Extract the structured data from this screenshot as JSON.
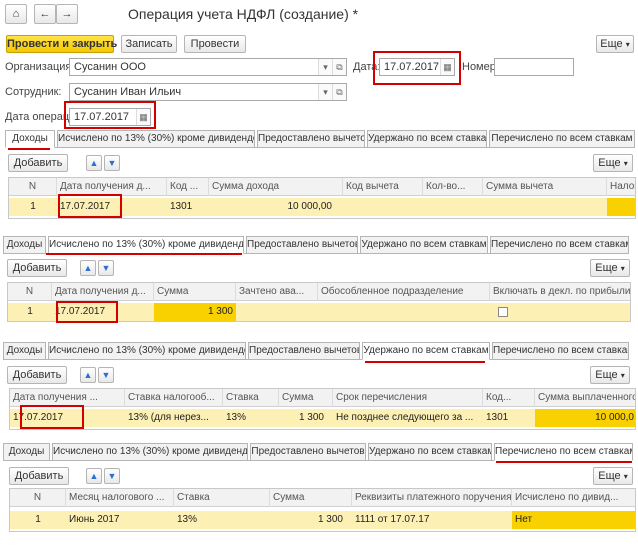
{
  "window": {
    "title": "Операция учета НДФЛ (создание) *"
  },
  "toolbar": {
    "post_close": "Провести и закрыть",
    "save": "Записать",
    "post": "Провести",
    "more": "Еще"
  },
  "form": {
    "org_label": "Организация:",
    "org_value": "Сусанин ООО",
    "date_label": "Дата:",
    "date_value": "17.07.2017",
    "number_label": "Номер:",
    "number_value": "",
    "employee_label": "Сотрудник:",
    "employee_value": "Сусанин Иван Ильич",
    "op_date_label": "Дата операции:",
    "op_date_value": "17.07.2017"
  },
  "tab_labels": [
    "Доходы",
    "Исчислено по 13% (30%) кроме дивидендов",
    "Предоставлено вычетов",
    "Удержано по всем ставкам",
    "Перечислено по всем ставкам"
  ],
  "section_buttons": {
    "add": "Добавить",
    "more": "Еще"
  },
  "sec1": {
    "headers": [
      "N",
      "Дата получения д...",
      "Код ...",
      "Сумма дохода",
      "Код вычета",
      "Кол-во...",
      "Сумма вычета",
      "Налог"
    ],
    "row": [
      "1",
      "17.07.2017",
      "1301",
      "10 000,00",
      "",
      "",
      "",
      ""
    ]
  },
  "sec2": {
    "headers": [
      "N",
      "Дата получения д...",
      "Сумма",
      "Зачтено ава...",
      "Обособленное подразделение",
      "Включать в декл. по прибыли"
    ],
    "row": [
      "1",
      "17.07.2017",
      "1 300",
      "",
      "",
      ""
    ]
  },
  "sec3": {
    "headers": [
      "Дата получения ...",
      "Ставка налогооб...",
      "Ставка",
      "Сумма",
      "Срок перечисления",
      "Код...",
      "Сумма выплаченного д..."
    ],
    "row": [
      "17.07.2017",
      "13% (для нерез...",
      "13%",
      "1 300",
      "Не позднее следующего за ...",
      "1301",
      "10 000,0"
    ]
  },
  "sec4": {
    "headers": [
      "N",
      "Месяц налогового ...",
      "Ставка",
      "Сумма",
      "Реквизиты платежного поручения",
      "Исчислено по дивид..."
    ],
    "row": [
      "1",
      "Июнь 2017",
      "13%",
      "1 300",
      "1111 от 17.07.17",
      "Нет"
    ]
  },
  "icons": [
    "home-icon",
    "back-arrow-icon",
    "forward-arrow-icon",
    "calendar-icon",
    "dropdown-icon",
    "open-icon",
    "up-arrow-icon",
    "down-arrow-icon"
  ],
  "colors": {
    "accent_yellow": "#f5c800",
    "row_highlight": "#fdf0b5",
    "annotation_red": "#d40000"
  }
}
